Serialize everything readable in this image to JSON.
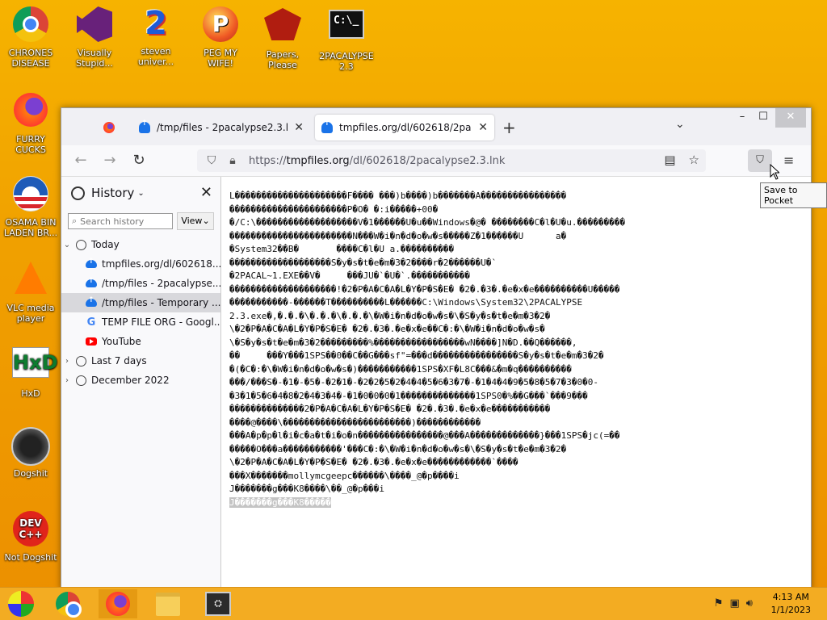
{
  "desktop": {
    "icons": [
      {
        "label": "CHRONES\nDISEASE",
        "icon": "chrome-icon"
      },
      {
        "label": "Visually\nStupid...",
        "icon": "visual-studio-icon"
      },
      {
        "label": "steven\nuniver...",
        "icon": "steven-universe-icon"
      },
      {
        "label": "PEG MY WIFE!",
        "icon": "peggle-icon"
      },
      {
        "label": "Papers,\nPlease",
        "icon": "papers-please-icon"
      },
      {
        "label": "2PACALYPSE\n2.3",
        "icon": "cmd-icon"
      },
      {
        "label": "FURRY CUCKS",
        "icon": "firefox-icon"
      },
      {
        "label": "OSAMA BIN\nLADEN BR...",
        "icon": "obama-logo-icon"
      },
      {
        "label": "VLC media\nplayer",
        "icon": "vlc-icon"
      },
      {
        "label": "HxD",
        "icon": "hxd-icon"
      },
      {
        "label": "Dogshit",
        "icon": "dogshit-icon"
      },
      {
        "label": "Not Dogshit",
        "icon": "devcpp-icon"
      }
    ],
    "devcpp_text": "DEV\nC++",
    "hxd_text": "HxD",
    "cmd_text": "C:\\_",
    "num2_text": "2",
    "peg_text": "P"
  },
  "browser": {
    "tabs": [
      {
        "title": "",
        "icon": "firefox-icon",
        "active": false
      },
      {
        "title": "/tmp/files - 2pacalypse2.3.lnk",
        "icon": "upload-cloud-icon",
        "active": false
      },
      {
        "title": "tmpfiles.org/dl/602618/2pacalyp",
        "icon": "upload-cloud-icon",
        "active": true
      }
    ],
    "tab_close": "✕",
    "new_tab": "+",
    "list_tabs": "⌄",
    "window_controls": {
      "min": "–",
      "max": "☐",
      "close": "✕"
    },
    "url": {
      "prefix": "https://",
      "host": "tmpfiles.org",
      "path": "/dl/602618/2pacalypse2.3.lnk"
    },
    "pocket_tooltip": "Save to Pocket"
  },
  "sidebar": {
    "title": "History",
    "search_placeholder": "Search history",
    "view_label": "View",
    "groups": [
      {
        "label": "Today",
        "expanded": true
      },
      {
        "label": "Last 7 days",
        "expanded": false
      },
      {
        "label": "December 2022",
        "expanded": false
      }
    ],
    "items": [
      {
        "label": "tmpfiles.org/dl/602618...",
        "icon": "upload-cloud-icon"
      },
      {
        "label": "/tmp/files - 2pacalypse...",
        "icon": "upload-cloud-icon"
      },
      {
        "label": "/tmp/files - Temporary ...",
        "icon": "upload-cloud-icon"
      },
      {
        "label": "TEMP FILE ORG - Googl...",
        "icon": "google-icon"
      },
      {
        "label": "YouTube",
        "icon": "youtube-icon"
      }
    ]
  },
  "content": {
    "lines": [
      "L���������������������F���� ���)b����)b�������A����������������",
      "����������������������P�O� �:i�����+00�",
      "�/C:\\�������������������V�1������U�u��Windows�@� ��������C�l�U�u.���������",
      "�����������������������N���W�i�n�d�o�w�s�����Z�1������U      a�",
      "�System32��B�       ����C�l�U a.����������",
      "�������������������S�y�s�t�e�m�3�2����r�2������U�`",
      "�2PACAL~1.EXE��V�     ���JU�`�U�`.�����������",
      "��������������������!�2�P�A�C�A�L�Y�P�S�E� �2�.�3�.�e�x�e����������U�����",
      "�����������-������T����������L������C:\\Windows\\System32\\2PACALYPSE",
      "2.3.exe�,�.�.�\\�.�.�\\�.�.�\\�W�i�n�d�o�w�s�\\�S�y�s�t�e�m�3�2�",
      "\\�2�P�A�C�A�L�Y�P�S�E� �2�.�3�.�e�x�e��C�:�\\�W�i�n�d�o�w�s�",
      "\\�S�y�s�t�e�m�3�2���������%�����������������wN����]N�D.��Q������,",
      "��     ���Y���1SPS��0��C��G���sf\"=���d����������������S�y�s�t�e�m�3�2�",
      "�(�C�:�\\�W�i�n�d�o�w�s�)�����������1SPS�XF�L8C���&�m�q����������",
      "���/���S�-�1�-�5�-�2�1�-�2�2�5�2�4�4�5�6�3�7�-�1�4�4�9�5�8�5�7�3�0�0-",
      "�3�1�5�6�4�8�2�4�3�4�-�1�0�0�0�1��������������1SPS0�%��G���`���9���",
      "��������������2�P�A�C�A�L�Y�P�S�E� �2�.�3�.�e�x�e�����������",
      "����@����\\������������������������)������������",
      "���A�p�p�l�i�c�a�t�i�o�n����������������@���A�������������}���1SPS�jc(=��",
      "�����O���a�����������'���C�:�\\�W�i�n�d�o�w�s�\\�S�y�s�t�e�m�3�2�",
      "\\�2�P�A�C�A�L�Y�P�S�E� �2�.�3�.�e�x�e������������`����",
      "���X�������mollymcgeepc������\\����_@�p����i",
      "J�������g���K8����\\��_@�p���i"
    ],
    "highlighted_line": "J�������g���K8�����"
  },
  "taskbar": {
    "time": "4:13 AM",
    "date": "1/1/2023",
    "apps": [
      "start-icon",
      "chrome-icon",
      "firefox-icon",
      "file-explorer-icon",
      "cmd-app-icon"
    ]
  }
}
